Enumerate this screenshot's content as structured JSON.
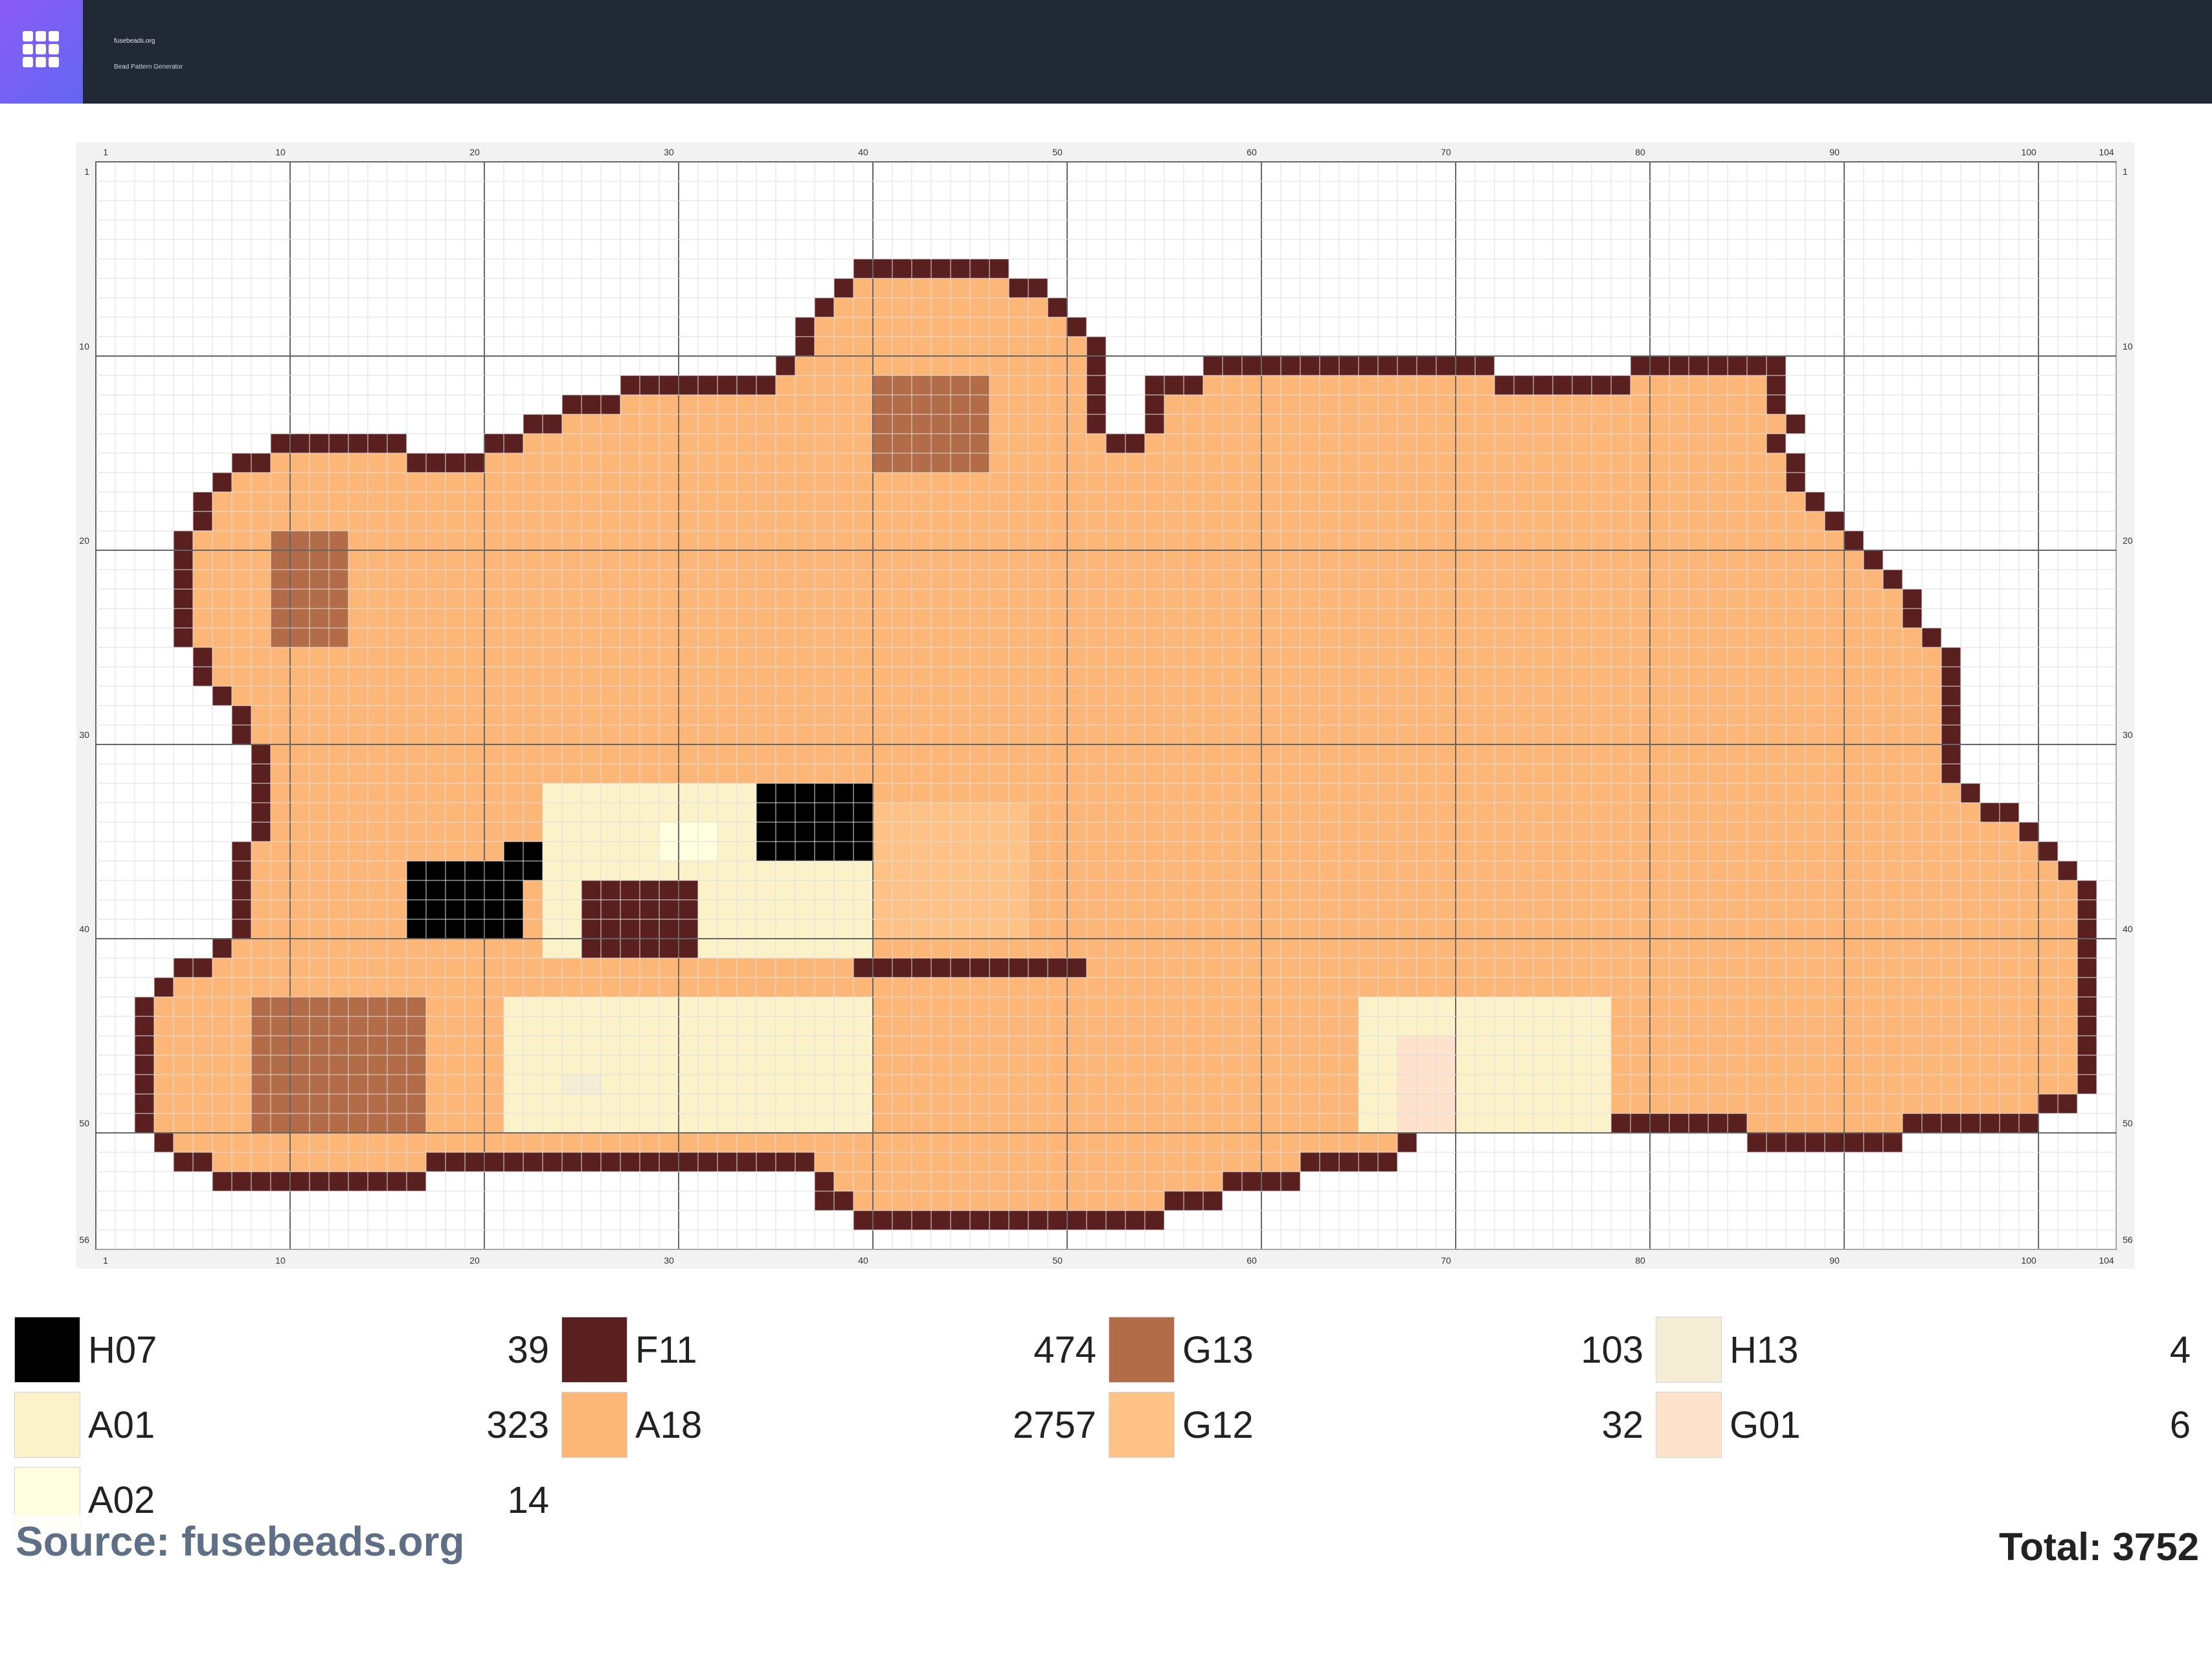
{
  "app": {
    "site_name": "fusebeads.org",
    "site_subtitle": "Bead Pattern Generator",
    "logo_icon": "grid-icon"
  },
  "grid": {
    "columns": 104,
    "rows": 56,
    "x_tick_labels": [
      "1",
      "10",
      "20",
      "30",
      "40",
      "50",
      "60",
      "70",
      "80",
      "90",
      "100",
      "104"
    ],
    "y_tick_labels": [
      "1",
      "10",
      "20",
      "30",
      "40",
      "50",
      "56"
    ],
    "major_every": 10
  },
  "colors": {
    "F11": "#5a1f1f",
    "A18": "#fbb678",
    "G13": "#b26c47",
    "H07": "#000000",
    "A01": "#fbf2ca",
    "G12": "#ffc286",
    "H13": "#f5ecd6",
    "G01": "#ffe2cc",
    "A02": "#ffffdf"
  },
  "legend": [
    {
      "code": "H07",
      "count": "39",
      "color": "#000000"
    },
    {
      "code": "F11",
      "count": "474",
      "color": "#5a1f1f"
    },
    {
      "code": "G13",
      "count": "103",
      "color": "#b26c47"
    },
    {
      "code": "H13",
      "count": "4",
      "color": "#f5ecd6"
    },
    {
      "code": "A01",
      "count": "323",
      "color": "#fbf2ca"
    },
    {
      "code": "A18",
      "count": "2757",
      "color": "#fbb678"
    },
    {
      "code": "G12",
      "count": "32",
      "color": "#ffc286"
    },
    {
      "code": "G01",
      "count": "6",
      "color": "#ffe2cc"
    },
    {
      "code": "A02",
      "count": "14",
      "color": "#ffffdf"
    }
  ],
  "footer": {
    "source": "Source: fusebeads.org",
    "total": "Total: 3752"
  }
}
